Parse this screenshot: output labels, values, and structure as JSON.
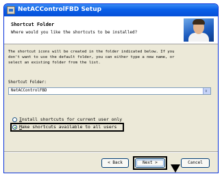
{
  "window": {
    "title": "NetACControlFBD Setup"
  },
  "header": {
    "title": "Shortcut Folder",
    "subtitle": "Where would you like the shortcuts to be installed?"
  },
  "body": {
    "description_lines": [
      "The shortcut icons will be created in the folder indicated below. If you",
      "don't want to use the default folder, you can either type a new name, or",
      "select an existing folder from the list."
    ]
  },
  "folder": {
    "label": "Shortcut Folder:",
    "value": "NetACControlFBD"
  },
  "options": [
    {
      "label": "Install shortcuts for current user only",
      "selected": false
    },
    {
      "label": "Make shortcuts available to all users",
      "selected": true
    }
  ],
  "buttons": {
    "back": "< Back",
    "next": "Next >",
    "cancel": "Cancel"
  },
  "colors": {
    "titlebar": "#0a5fe8",
    "window_bg": "#ece9d8",
    "highlight": "#000000"
  }
}
